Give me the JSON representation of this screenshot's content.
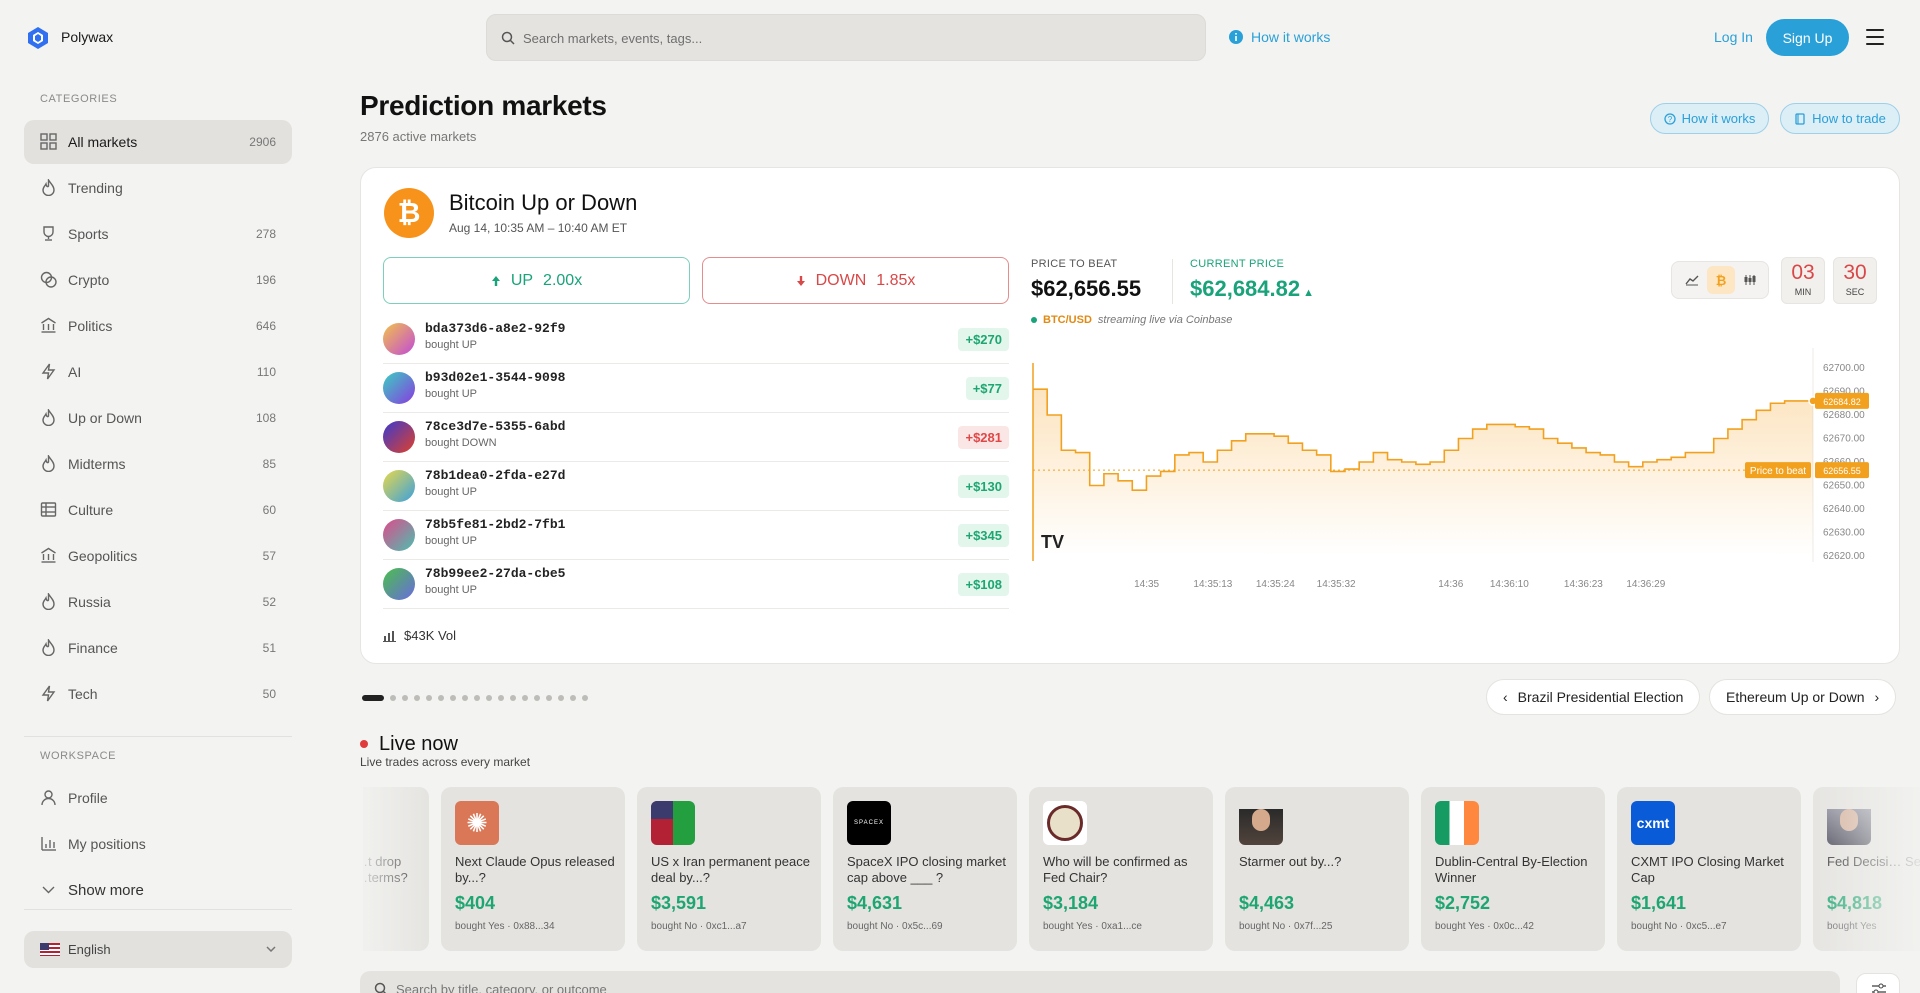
{
  "app": {
    "brand": "Polywax"
  },
  "search": {
    "placeholder": "Search markets, events, tags..."
  },
  "header": {
    "how_it_works": "How it works",
    "login": "Log In",
    "signup": "Sign Up"
  },
  "sidebar": {
    "categories_heading": "CATEGORIES",
    "items": [
      {
        "label": "All markets",
        "count": "2906",
        "icon": "grid-icon"
      },
      {
        "label": "Trending",
        "count": "",
        "icon": "flame-icon"
      },
      {
        "label": "Sports",
        "count": "278",
        "icon": "trophy-icon"
      },
      {
        "label": "Crypto",
        "count": "196",
        "icon": "coins-icon"
      },
      {
        "label": "Politics",
        "count": "646",
        "icon": "landmark-icon"
      },
      {
        "label": "AI",
        "count": "110",
        "icon": "bolt-icon"
      },
      {
        "label": "Up or Down",
        "count": "108",
        "icon": "flame-icon"
      },
      {
        "label": "Midterms",
        "count": "85",
        "icon": "flame-icon"
      },
      {
        "label": "Culture",
        "count": "60",
        "icon": "film-icon"
      },
      {
        "label": "Geopolitics",
        "count": "57",
        "icon": "landmark-icon"
      },
      {
        "label": "Russia",
        "count": "52",
        "icon": "flame-icon"
      },
      {
        "label": "Finance",
        "count": "51",
        "icon": "flame-icon"
      },
      {
        "label": "Tech",
        "count": "50",
        "icon": "bolt-icon"
      }
    ],
    "workspace_heading": "WORKSPACE",
    "workspace": [
      {
        "label": "Profile",
        "icon": "user-icon"
      },
      {
        "label": "My positions",
        "icon": "bar-chart-icon"
      },
      {
        "label": "Show more",
        "icon": "chevron-down-icon"
      }
    ],
    "language": "English"
  },
  "page": {
    "title": "Prediction markets",
    "active": "2876 active markets",
    "how_it_works": "How it works",
    "how_to_trade": "How to trade"
  },
  "featured": {
    "title": "Bitcoin Up or Down",
    "date": "Aug 14, 10:35 AM – 10:40 AM ET",
    "up_label": "UP",
    "up_mult": "2.00x",
    "down_label": "DOWN",
    "down_mult": "1.85x",
    "trades": [
      {
        "addr": "bda373d6-a8e2-92f9",
        "action": "bought UP",
        "amount": "+$270",
        "dir": "up",
        "colors": [
          "#f2c24a",
          "#c24ad8"
        ]
      },
      {
        "addr": "b93d02e1-3544-9098",
        "action": "bought UP",
        "amount": "+$77",
        "dir": "up",
        "colors": [
          "#3ad0c0",
          "#8a3ae0"
        ]
      },
      {
        "addr": "78ce3d7e-5355-6abd",
        "action": "bought DOWN",
        "amount": "+$281",
        "dir": "down",
        "colors": [
          "#3a3ad0",
          "#e0402a"
        ]
      },
      {
        "addr": "78b1dea0-2fda-e27d",
        "action": "bought UP",
        "amount": "+$130",
        "dir": "up",
        "colors": [
          "#e8d84a",
          "#3aa0e0"
        ]
      },
      {
        "addr": "78b5fe81-2bd2-7fb1",
        "action": "bought UP",
        "amount": "+$345",
        "dir": "up",
        "colors": [
          "#e04a8a",
          "#4ac0b0"
        ]
      },
      {
        "addr": "78b99ee2-27da-cbe5",
        "action": "bought UP",
        "amount": "+$108",
        "dir": "up",
        "colors": [
          "#4ac04a",
          "#6a6ae0"
        ]
      }
    ],
    "volume": "$43K Vol",
    "price_to_beat_label": "PRICE TO BEAT",
    "price_to_beat": "$62,656.55",
    "current_label": "CURRENT PRICE",
    "current": "$62,684.82",
    "feed_pair": "BTC/USD",
    "feed_via": "streaming live via Coinbase",
    "timer_min": "03",
    "timer_min_label": "MIN",
    "timer_sec": "30",
    "timer_sec_label": "SEC",
    "ptb_tag": "Price to beat",
    "ptb_value": "62656.55",
    "current_tag": "62684.82"
  },
  "chart_data": {
    "type": "area",
    "series": [
      {
        "name": "BTC/USD",
        "values": [
          62691,
          62680,
          62665,
          62664,
          62650,
          62655,
          62652,
          62648,
          62654,
          62656,
          62663,
          62664,
          62660,
          62665,
          62669,
          62672,
          62672,
          62671,
          62668,
          62665,
          62663,
          62656,
          62657,
          62660,
          62664,
          62661,
          62660,
          62659,
          62660,
          62665,
          62670,
          62674,
          62676,
          62676,
          62675,
          62674,
          62670,
          62668,
          62666,
          62664,
          62663,
          62660,
          62658,
          62660,
          62661,
          62662,
          62664,
          62664,
          62670,
          62674,
          62678,
          62682,
          62685,
          62686,
          62686,
          62686
        ]
      }
    ],
    "x_ticks": [
      "14:35",
      "14:35:13",
      "14:35:24",
      "14:35:32",
      "14:36",
      "14:36:10",
      "14:36:23",
      "14:36:29"
    ],
    "y_ticks": [
      "62700.00",
      "62690.00",
      "62680.00",
      "62670.00",
      "62660.00",
      "62650.00",
      "62640.00",
      "62630.00",
      "62620.00"
    ],
    "ylim": [
      62620,
      62700
    ],
    "reference": 62656.55,
    "color": "#f2a11e"
  },
  "carousel": {
    "pages": 18,
    "current": 0,
    "prev": "Brazil Presidential Election",
    "next": "Ethereum Up or Down"
  },
  "live": {
    "title": "Live now",
    "subtitle": "Live trades across every market",
    "cards": [
      {
        "question": "…t drop …terms?",
        "amount": "",
        "sub": "",
        "icon": "none"
      },
      {
        "question": "Next Claude Opus released by...?",
        "amount": "$404",
        "sub": "bought Yes · 0x88...34",
        "icon": "claude-logo-icon"
      },
      {
        "question": "US x Iran permanent peace deal by...?",
        "amount": "$3,591",
        "sub": "bought No · 0xc1...a7",
        "icon": "us-iran-flag-icon"
      },
      {
        "question": "SpaceX IPO closing market cap above ___ ?",
        "amount": "$4,631",
        "sub": "bought No · 0x5c...69",
        "icon": "spacex-logo-icon"
      },
      {
        "question": "Who will be confirmed as Fed Chair?",
        "amount": "$3,184",
        "sub": "bought Yes · 0xa1...ce",
        "icon": "fed-seal-icon"
      },
      {
        "question": "Starmer out by...?",
        "amount": "$4,463",
        "sub": "bought No · 0x7f...25",
        "icon": "starmer-photo-icon"
      },
      {
        "question": "Dublin-Central By-Election Winner",
        "amount": "$2,752",
        "sub": "bought Yes · 0x0c...42",
        "icon": "ireland-flag-icon"
      },
      {
        "question": "CXMT IPO Closing Market Cap",
        "amount": "$1,641",
        "sub": "bought No · 0xc5...e7",
        "icon": "cxmt-logo-icon"
      },
      {
        "question": "Fed Decisi… Septembe…",
        "amount": "$4,818",
        "sub": "bought Yes",
        "icon": "portrait-icon"
      }
    ]
  },
  "bottom_search": {
    "placeholder": "Search by title, category, or outcome"
  }
}
